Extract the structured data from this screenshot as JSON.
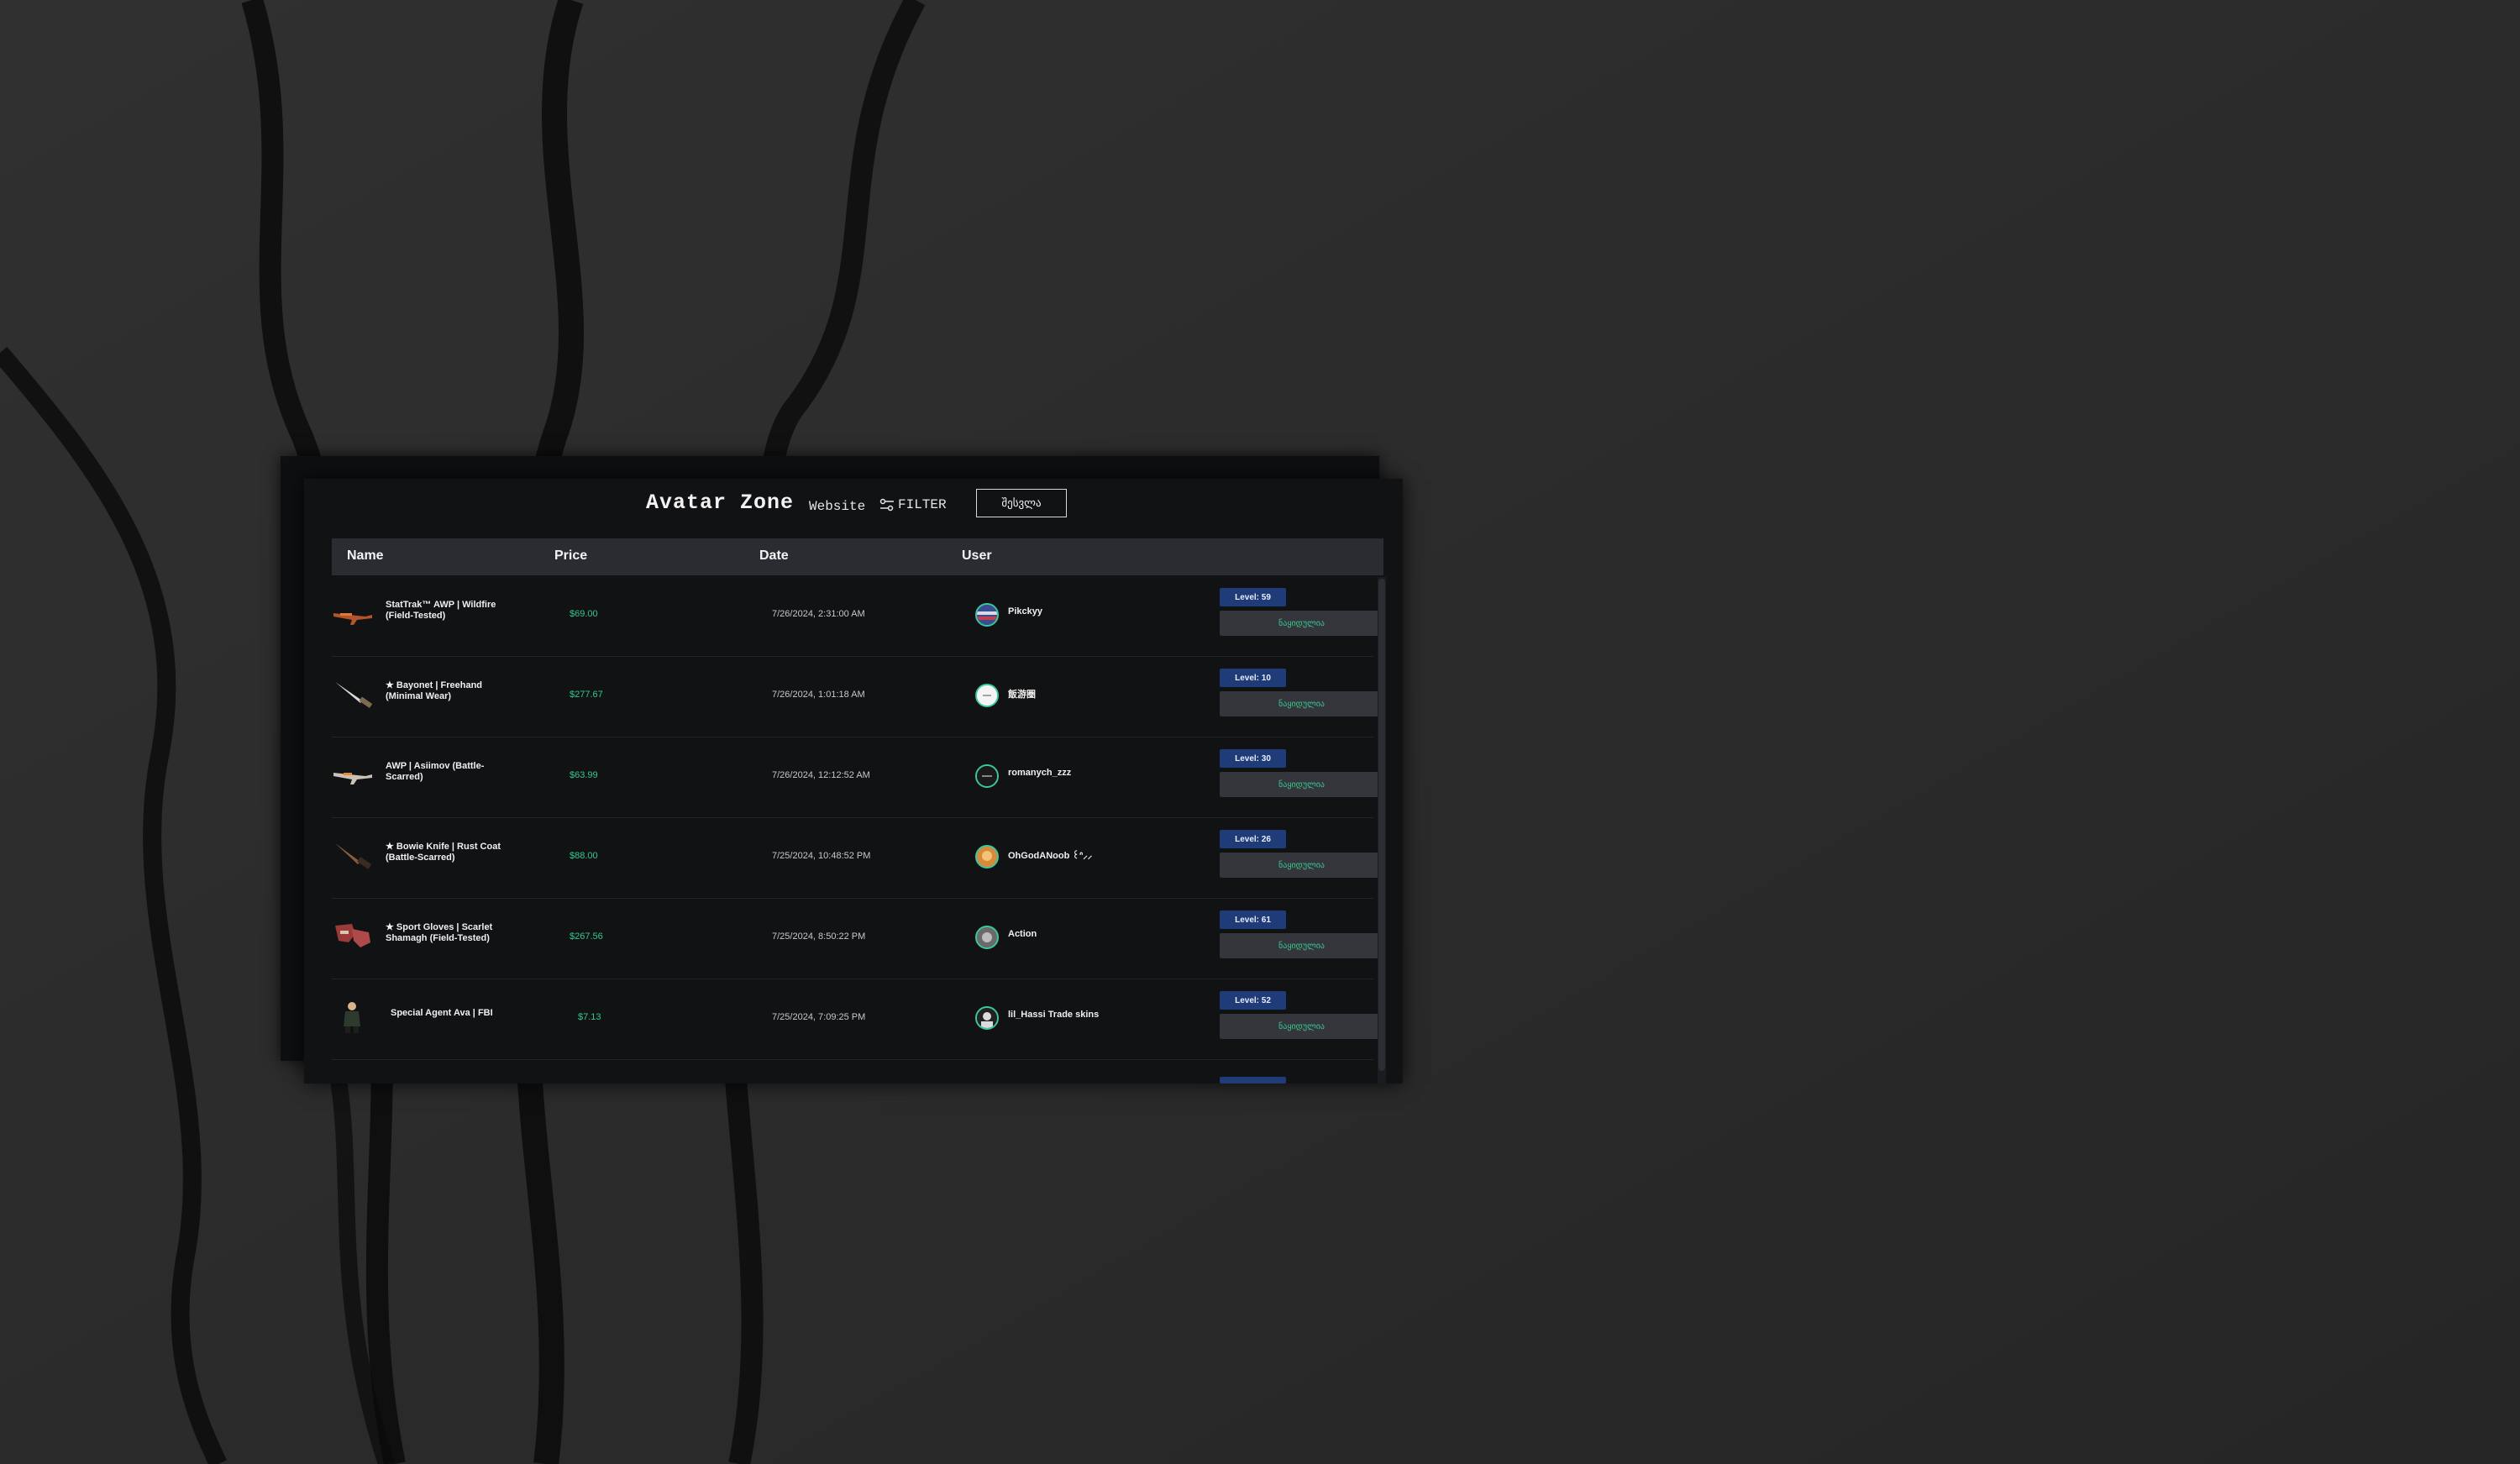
{
  "header": {
    "brand": "Avatar Zone",
    "website_link": "Website",
    "filter_label": "FILTER",
    "login_button": "შესვლა"
  },
  "table": {
    "columns": [
      "Name",
      "Price",
      "Date",
      "User"
    ],
    "rows": [
      {
        "name": "StatTrak™ AWP | Wildfire (Field-Tested)",
        "price": "$69.00",
        "date": "7/26/2024, 2:31:00 AM",
        "user": "Pikckyy",
        "level": "Level: 59",
        "action": "ნაყიდულია",
        "icon": "rifle-icon",
        "avatar": "flag-avatar"
      },
      {
        "name": "★ Bayonet | Freehand (Minimal Wear)",
        "price": "$277.67",
        "date": "7/26/2024, 1:01:18 AM",
        "user": "飯游圈",
        "level": "Level: 10",
        "action": "ნაყიდულია",
        "icon": "knife-icon",
        "avatar": "white-avatar"
      },
      {
        "name": "AWP | Asiimov (Battle-Scarred)",
        "price": "$63.99",
        "date": "7/26/2024, 12:12:52 AM",
        "user": "romanych_zzz",
        "level": "Level: 30",
        "action": "ნაყიდულია",
        "icon": "rifle-icon",
        "avatar": "dark-avatar"
      },
      {
        "name": "★ Bowie Knife | Rust Coat (Battle-Scarred)",
        "price": "$88.00",
        "date": "7/25/2024, 10:48:52 PM",
        "user": "OhGodANoob ꒰ᐢ⸝⸝",
        "level": "Level: 26",
        "action": "ნაყიდულია",
        "icon": "knife-icon",
        "avatar": "orange-avatar"
      },
      {
        "name": "★ Sport Gloves | Scarlet Shamagh (Field-Tested)",
        "price": "$267.56",
        "date": "7/25/2024, 8:50:22 PM",
        "user": "Action",
        "level": "Level: 61",
        "action": "ნაყიდულია",
        "icon": "gloves-icon",
        "avatar": "gray-avatar"
      },
      {
        "name": "Special Agent Ava | FBI",
        "price": "$7.13",
        "date": "7/25/2024, 7:09:25 PM",
        "user": "lil_Hassi Trade skins",
        "level": "Level: 52",
        "action": "ნაყიდულია",
        "icon": "agent-icon",
        "avatar": "bw-avatar"
      }
    ]
  },
  "colors": {
    "accent_green": "#37c88f",
    "level_blue": "#1f3b78",
    "panel_bg": "#111214",
    "header_bg": "#2a2c31"
  }
}
